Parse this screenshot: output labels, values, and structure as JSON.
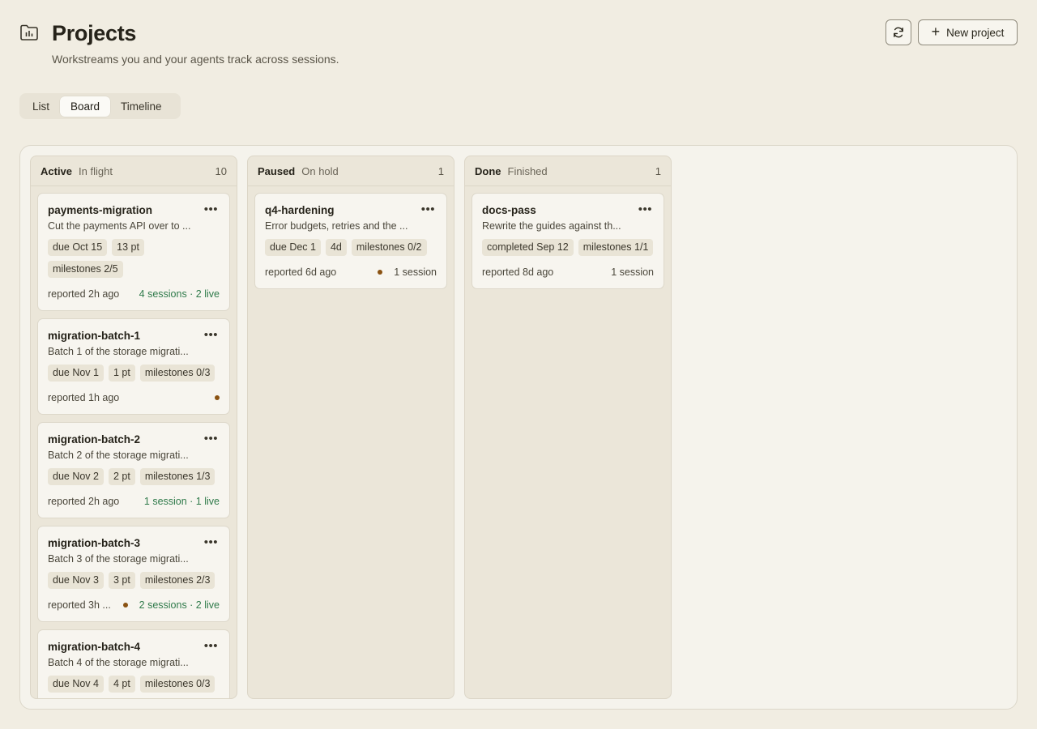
{
  "header": {
    "title": "Projects",
    "subtitle": "Workstreams you and your agents track across sessions.",
    "icon": "folder-chart-icon",
    "refresh_icon": "refresh-icon",
    "new_project_label": "New project"
  },
  "view_tabs": {
    "items": [
      {
        "label": "List",
        "active": false
      },
      {
        "label": "Board",
        "active": true
      },
      {
        "label": "Timeline",
        "active": false
      }
    ]
  },
  "board": {
    "columns": [
      {
        "title": "Active",
        "subtitle": "In flight",
        "count": "10",
        "cards": [
          {
            "name": "payments-migration",
            "desc": "Cut the payments API over to ...",
            "chips": [
              "due Oct 15",
              "13 pt",
              "milestones 2/5"
            ],
            "reported": "reported 2h ago",
            "sessions": "4 sessions · 2 live",
            "live": true,
            "dot": false
          },
          {
            "name": "migration-batch-1",
            "desc": "Batch 1 of the storage migrati...",
            "chips": [
              "due Nov 1",
              "1 pt",
              "milestones 0/3"
            ],
            "reported": "reported 1h ago",
            "sessions": "",
            "live": false,
            "dot": true
          },
          {
            "name": "migration-batch-2",
            "desc": "Batch 2 of the storage migrati...",
            "chips": [
              "due Nov 2",
              "2 pt",
              "milestones 1/3"
            ],
            "reported": "reported 2h ago",
            "sessions": "1 session · 1 live",
            "live": true,
            "dot": false
          },
          {
            "name": "migration-batch-3",
            "desc": "Batch 3 of the storage migrati...",
            "chips": [
              "due Nov 3",
              "3 pt",
              "milestones 2/3"
            ],
            "reported": "reported 3h ...",
            "sessions": "2 sessions · 2 live",
            "live": true,
            "dot": true
          },
          {
            "name": "migration-batch-4",
            "desc": "Batch 4 of the storage migrati...",
            "chips": [
              "due Nov 4",
              "4 pt",
              "milestones 0/3"
            ],
            "reported": "",
            "sessions": "",
            "live": false,
            "dot": false
          }
        ]
      },
      {
        "title": "Paused",
        "subtitle": "On hold",
        "count": "1",
        "cards": [
          {
            "name": "q4-hardening",
            "desc": "Error budgets, retries and the ...",
            "chips": [
              "due Dec 1",
              "4d",
              "milestones 0/2"
            ],
            "reported": "reported 6d ago",
            "sessions": "1 session",
            "live": false,
            "dot": true
          }
        ]
      },
      {
        "title": "Done",
        "subtitle": "Finished",
        "count": "1",
        "cards": [
          {
            "name": "docs-pass",
            "desc": "Rewrite the guides against th...",
            "chips": [
              "completed Sep 12",
              "milestones 1/1"
            ],
            "reported": "reported 8d ago",
            "sessions": "1 session",
            "live": false,
            "dot": false
          }
        ]
      }
    ]
  }
}
